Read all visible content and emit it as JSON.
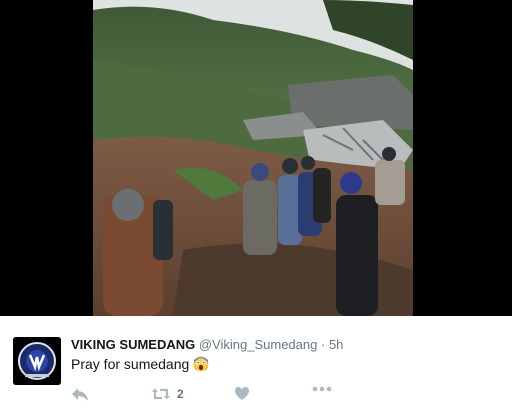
{
  "tweet": {
    "display_name": "VIKING SUMEDANG",
    "handle": "@Viking_Sumedang",
    "separator": "·",
    "time": "5h",
    "text": "Pray for sumedang",
    "emoji": "face-screaming-in-fear",
    "retweet_count": "2"
  },
  "icons": {
    "reply": "reply-icon",
    "retweet": "retweet-icon",
    "like": "heart-icon",
    "more": "more-icon"
  },
  "colors": {
    "name": "#14171a",
    "secondary": "#657786",
    "icon": "#aab8c2"
  }
}
